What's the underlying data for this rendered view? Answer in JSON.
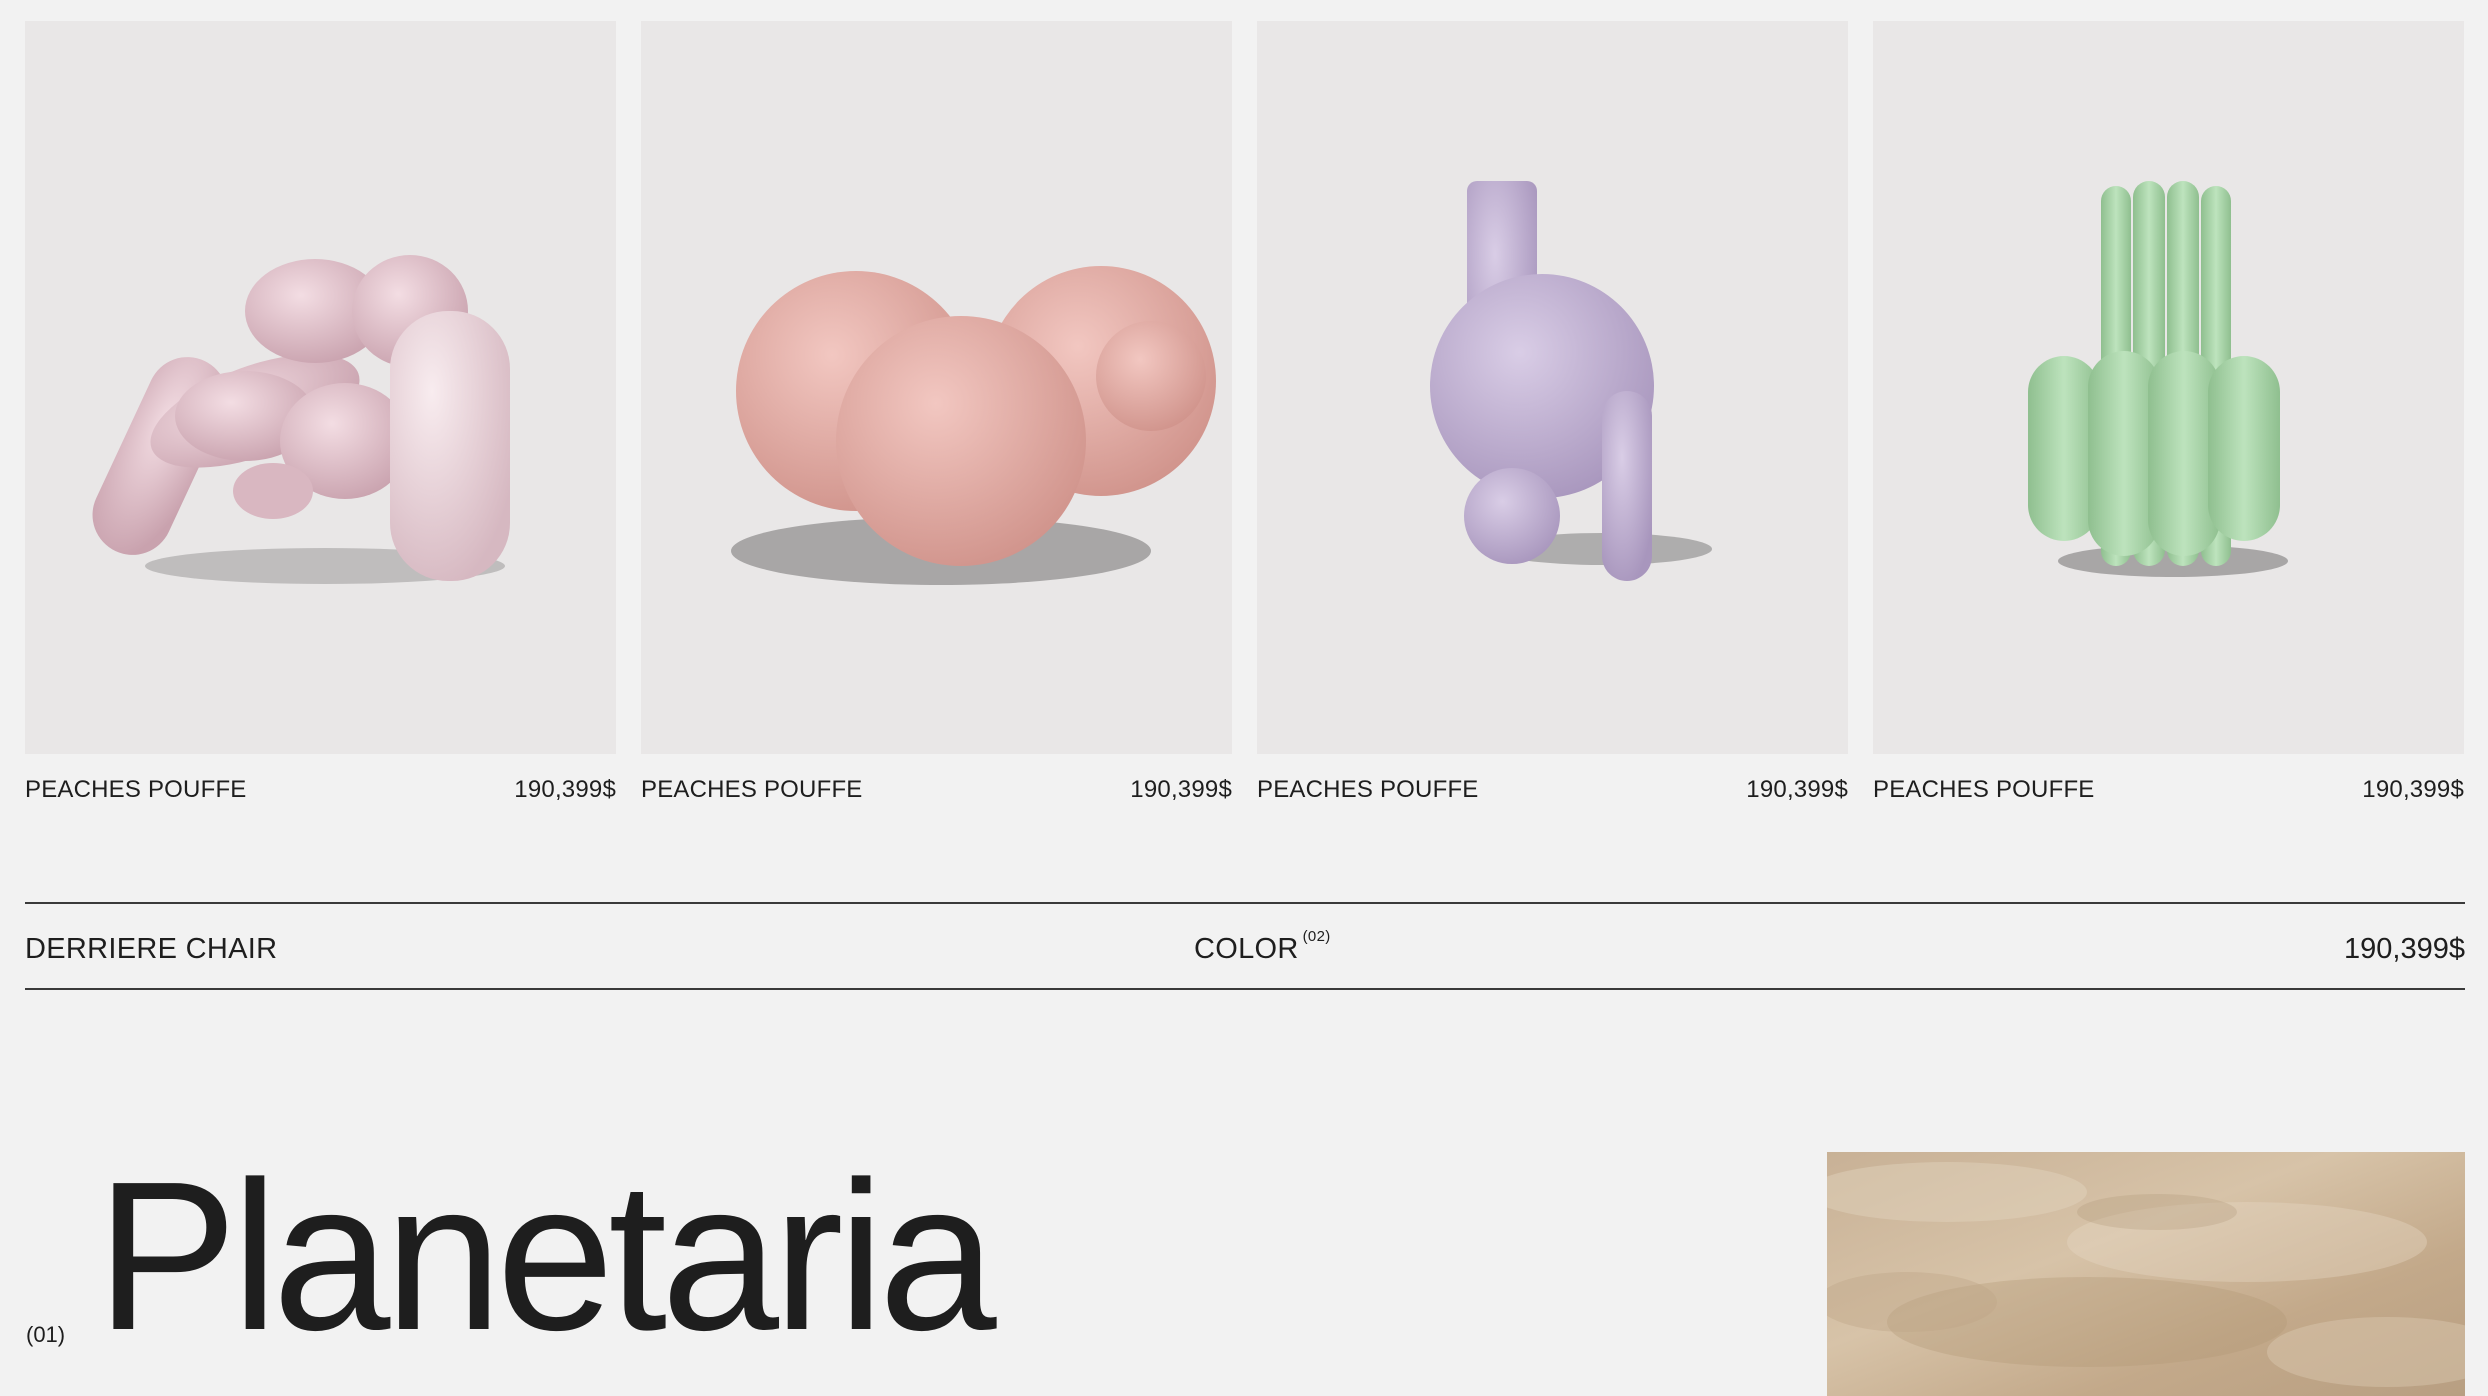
{
  "products": [
    {
      "name": "PEACHES POUFFE",
      "price": "190,399$",
      "image": "pink-knotted-armchair",
      "color": "#e4c9d1"
    },
    {
      "name": "PEACHES POUFFE",
      "price": "190,399$",
      "image": "peach-bubble-pouffe",
      "color": "#e8b1aa"
    },
    {
      "name": "PEACHES POUFFE",
      "price": "190,399$",
      "image": "lilac-sphere-sculpture",
      "color": "#c0aed2"
    },
    {
      "name": "PEACHES POUFFE",
      "price": "190,399$",
      "image": "mint-tube-sculpture",
      "color": "#a6d2a6"
    }
  ],
  "detail": {
    "name": "DERRIERE CHAIR",
    "color_label": "COLOR",
    "color_count": "(02)",
    "price": "190,399$"
  },
  "hero": {
    "index": "(01)",
    "title": "Planetaria",
    "image": "beige-plaster-texture"
  },
  "colors": {
    "background": "#f2f2f2",
    "card_background": "#e9e7e7",
    "text": "#1e1e1e"
  }
}
